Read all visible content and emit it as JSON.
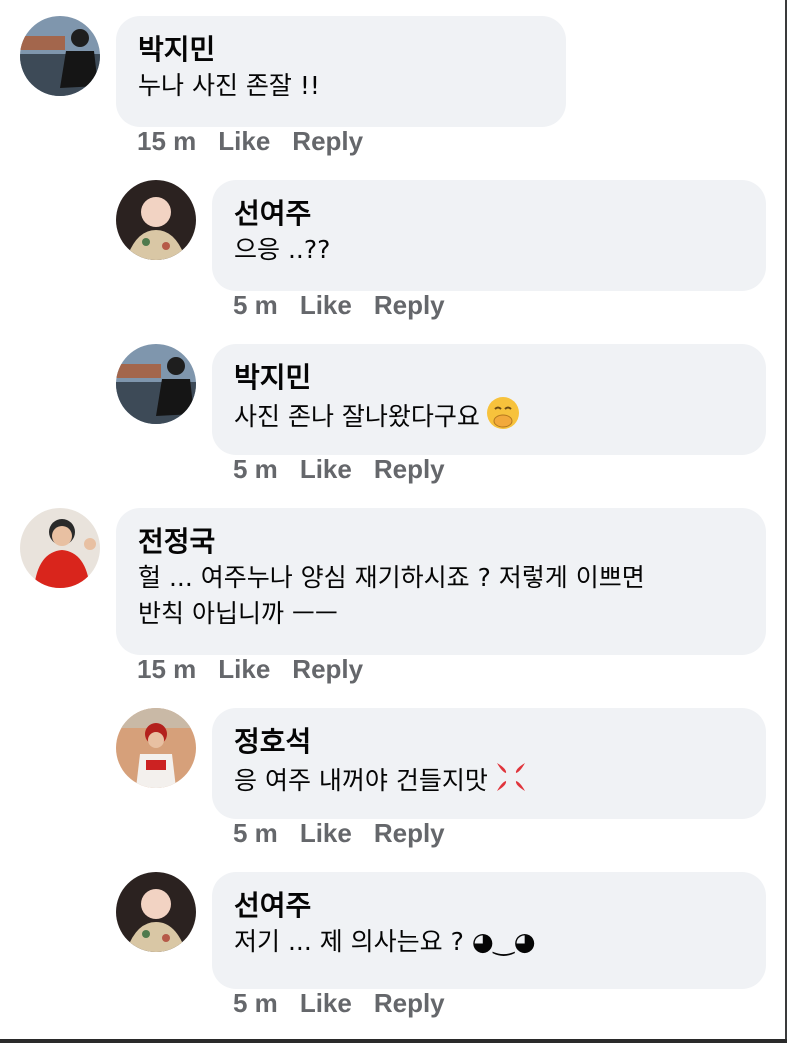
{
  "comments": [
    {
      "name": "박지민",
      "text": "누나 사진 존잘 !!",
      "time": "15 m",
      "like": "Like",
      "reply": "Reply",
      "emoji": ""
    },
    {
      "name": "선여주",
      "text": "으응 ..??",
      "time": "5 m",
      "like": "Like",
      "reply": "Reply",
      "emoji": ""
    },
    {
      "name": "박지민",
      "text": "사진 존나 잘나왔다구요",
      "time": "5 m",
      "like": "Like",
      "reply": "Reply",
      "emoji": "hand-over-mouth-emoji"
    },
    {
      "name": "전정국",
      "text": "헐 ... 여주누나 양심 재기하시죠 ? 저렇게 이쁘면",
      "text2": "반칙 아닙니까 ㅡㅡ",
      "time": "15 m",
      "like": "Like",
      "reply": "Reply",
      "emoji": ""
    },
    {
      "name": "정호석",
      "text": "응 여주 내꺼야 건들지맛",
      "time": "5 m",
      "like": "Like",
      "reply": "Reply",
      "emoji": "anger-symbol-emoji"
    },
    {
      "name": "선여주",
      "text": "저기 ... 제 의사는요 ? ◕‿◕",
      "time": "5 m",
      "like": "Like",
      "reply": "Reply",
      "emoji": ""
    }
  ],
  "colors": {
    "bubble": "#f0f2f5",
    "meta": "#65676b",
    "text": "#050505"
  }
}
